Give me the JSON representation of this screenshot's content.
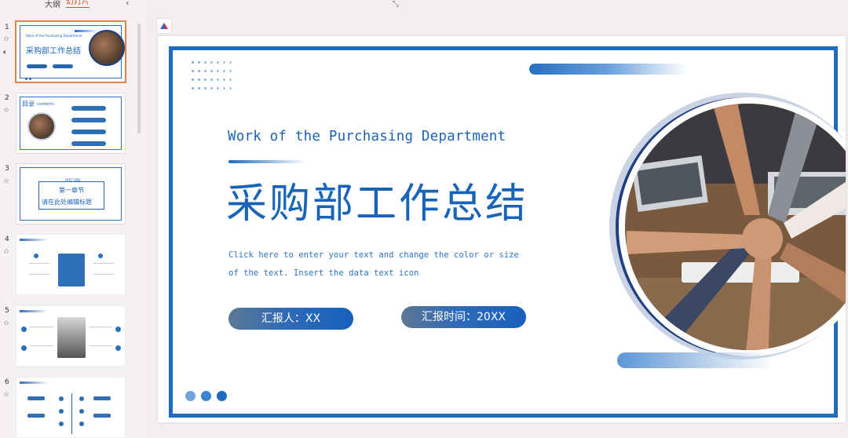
{
  "pane": {
    "tabs": [
      "大纲",
      "幻灯片"
    ],
    "collapse_glyph": "‹"
  },
  "thumbnails": [
    {
      "num": "1",
      "title": "采购部工作总结",
      "subtitle": "Work of the Purchasing Department",
      "pill_a": "汇报人：XX",
      "pill_b": "汇报时间：20XX"
    },
    {
      "num": "2",
      "title": "目录",
      "subtitle": "contents",
      "items": [
        "添加标题",
        "添加标题",
        "添加标题",
        "添加标题"
      ]
    },
    {
      "num": "3",
      "part": "PART ONE",
      "title": "第一章节",
      "subtitle": "请在此处编辑标题"
    },
    {
      "num": "4"
    },
    {
      "num": "5"
    },
    {
      "num": "6"
    }
  ],
  "slide": {
    "subtitle_en": "Work of the Purchasing Department",
    "title": "采购部工作总结",
    "body_line1": "Click here to enter your text and change the color or size",
    "body_line2": "of the text. Insert the data text icon",
    "reporter": "汇报人：XX",
    "report_time": "汇报时间：20XX"
  },
  "colors": {
    "accent": "#1f6bbf",
    "title": "#1764b8",
    "selection": "#e0814f",
    "dot_light": "#6fa3dc",
    "dot_mid": "#3b82cf",
    "dot_dark": "#1f6bbf"
  },
  "icons": {
    "app_logo": "ai-assistant-icon",
    "star": "star-icon",
    "audio": "speaker-icon"
  }
}
